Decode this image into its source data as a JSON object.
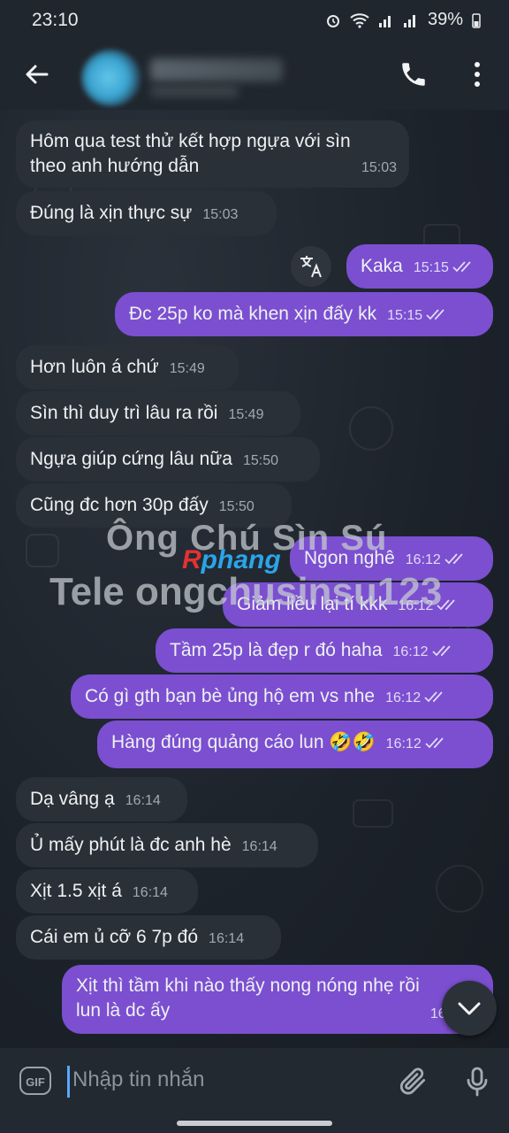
{
  "status": {
    "time": "23:10",
    "battery": "39%"
  },
  "header": {
    "back_icon": "arrow-left-icon",
    "call_icon": "phone-icon",
    "more_icon": "more-vertical-icon"
  },
  "messages": [
    {
      "text": "Hôm qua test thử kết hợp ngựa với sìn\ntheo anh hướng dẫn",
      "time": "15:03",
      "dir": "in"
    },
    {
      "text": "Đúng là xịn thực sự",
      "time": "15:03",
      "dir": "in"
    },
    {
      "text": "Kaka",
      "time": "15:15",
      "dir": "out"
    },
    {
      "text": "Đc 25p ko mà khen xịn đấy kk",
      "time": "15:15",
      "dir": "out"
    },
    {
      "text": "Hơn luôn á chứ",
      "time": "15:49",
      "dir": "in"
    },
    {
      "text": "Sìn thì duy trì lâu ra rồi",
      "time": "15:49",
      "dir": "in"
    },
    {
      "text": "Ngựa giúp cứng lâu nữa",
      "time": "15:50",
      "dir": "in"
    },
    {
      "text": "Cũng đc hơn 30p đấy",
      "time": "15:50",
      "dir": "in"
    },
    {
      "text": "Ngon nghê",
      "time": "16:12",
      "dir": "out"
    },
    {
      "text": "Giảm liều lại tí kkk",
      "time": "16:12",
      "dir": "out"
    },
    {
      "text": "Tầm 25p là đẹp r đó haha",
      "time": "16:12",
      "dir": "out"
    },
    {
      "text": "Có gì gth bạn bè ủng hộ em vs nhe",
      "time": "16:12",
      "dir": "out"
    },
    {
      "text": "Hàng đúng quảng cáo lun 🤣🤣",
      "time": "16:12",
      "dir": "out"
    },
    {
      "text": "Dạ vâng ạ",
      "time": "16:14",
      "dir": "in"
    },
    {
      "text": "Ủ mấy phút là đc anh hè",
      "time": "16:14",
      "dir": "in"
    },
    {
      "text": "Xịt 1.5 xịt á",
      "time": "16:14",
      "dir": "in"
    },
    {
      "text": "Cái em ủ cỡ 6 7p đó",
      "time": "16:14",
      "dir": "in"
    },
    {
      "text": "Xịt thì tầm khi nào thấy nong nóng nhẹ rồi\nlun là dc ấy",
      "time": "16:4",
      "dir": "out"
    }
  ],
  "watermark": {
    "line1": "Ông Chú Sìn Sú",
    "line2": "Tele ongchusinsu123",
    "logo_a": "R",
    "logo_b": "phang"
  },
  "input": {
    "placeholder": "Nhập tin nhắn",
    "gif_label": "GIF"
  },
  "icons": {
    "translate": "translate-icon",
    "scroll": "chevron-down-icon",
    "attach": "paperclip-icon",
    "mic": "microphone-icon"
  }
}
